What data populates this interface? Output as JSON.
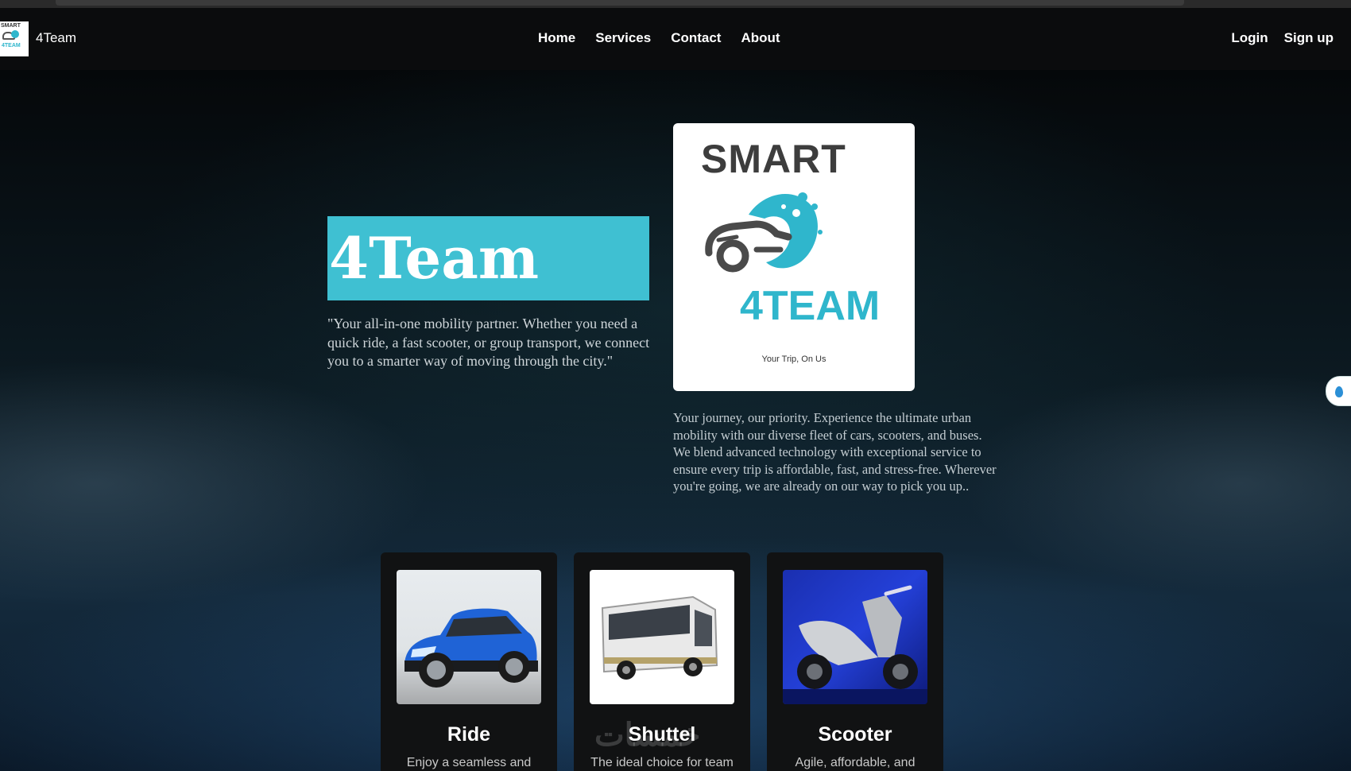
{
  "header": {
    "brand_name": "4Team",
    "nav": [
      {
        "label": "Home"
      },
      {
        "label": "Services"
      },
      {
        "label": "Contact"
      },
      {
        "label": "About"
      }
    ],
    "login_label": "Login",
    "signup_label": "Sign up"
  },
  "hero": {
    "title": "4Team",
    "quote": "\"Your all-in-one mobility partner. Whether you need a quick ride, a fast scooter, or group transport, we connect you to a smarter way of moving through the city.\"",
    "logo": {
      "top_text": "SMART",
      "bottom_text": "4TEAM",
      "tagline": "Your Trip, On Us"
    },
    "about": "Your journey, our priority. Experience the ultimate urban mobility with our diverse fleet of cars, scooters, and buses. We blend advanced technology with exceptional service to ensure every trip is affordable, fast, and stress-free. Wherever you're going, we are already on our way to pick you up.."
  },
  "services": [
    {
      "title": "Ride",
      "description": "Enjoy a seamless and",
      "icon": "car-photo"
    },
    {
      "title": "Shuttel",
      "description": "The ideal choice for team",
      "icon": "bus-photo"
    },
    {
      "title": "Scooter",
      "description": "Agile, affordable, and",
      "icon": "scooter-photo"
    }
  ],
  "watermark": "خمسات",
  "colors": {
    "accent": "#3fc0d2",
    "navbar": "#0b0c0d",
    "card": "#111213"
  }
}
